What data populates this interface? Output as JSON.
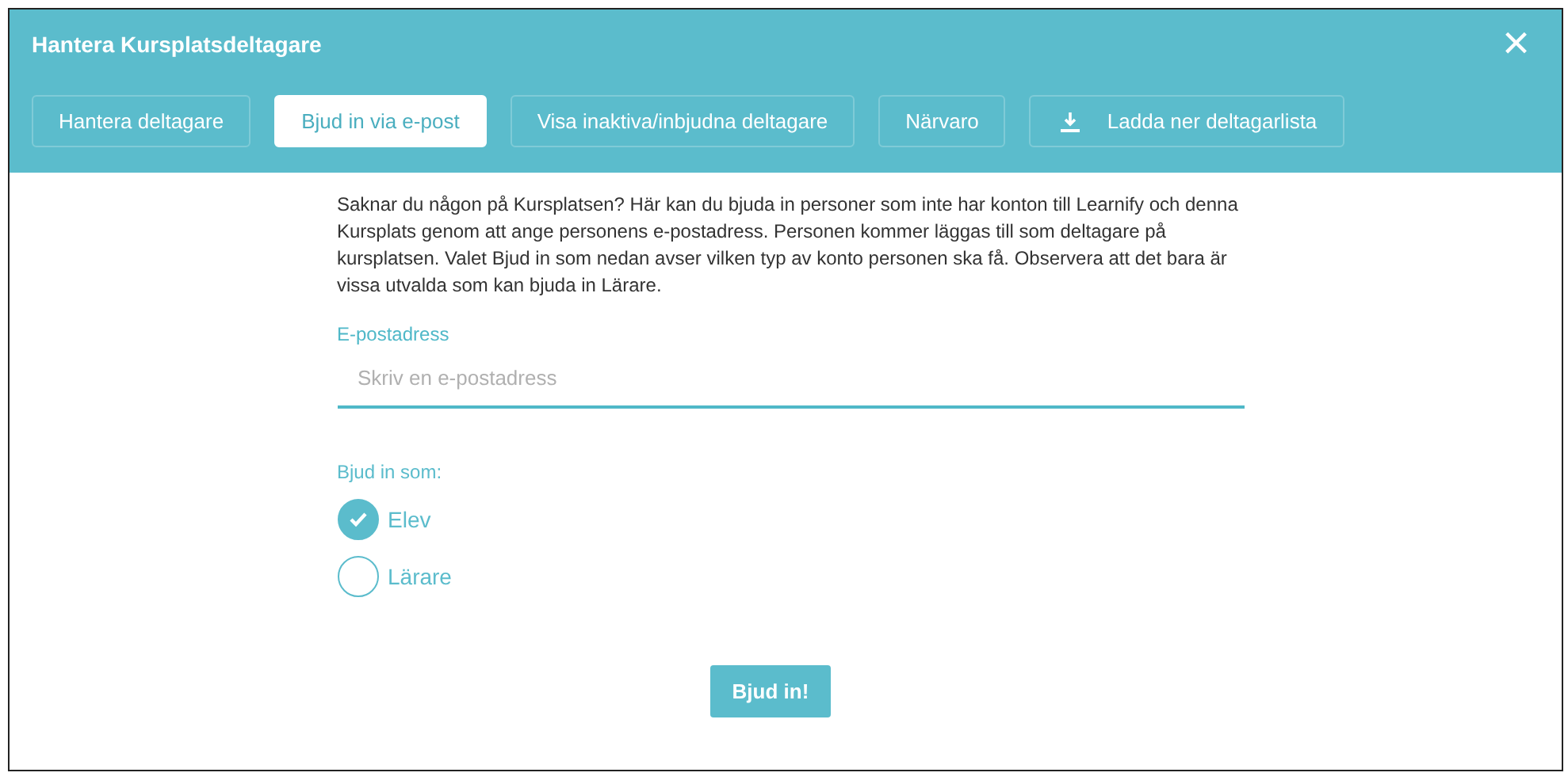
{
  "window": {
    "title": "Hantera Kursplatsdeltagare",
    "close": "×"
  },
  "tabs": [
    {
      "label": "Hantera deltagare",
      "selected": false,
      "kind": "text"
    },
    {
      "label": "Bjud in via e-post",
      "selected": true,
      "kind": "text"
    },
    {
      "label": "Visa inaktiva/inbjudna deltagare",
      "selected": false,
      "kind": "text"
    },
    {
      "label": "Närvaro",
      "selected": false,
      "kind": "text"
    },
    {
      "label": "Ladda ner deltagarlista",
      "selected": false,
      "kind": "download"
    }
  ],
  "description": "Saknar du någon på Kursplatsen? Här kan du bjuda in personer som inte har konton till Learnify och denna Kursplats genom att ange personens e-postadress. Personen kommer läggas till som deltagare på kursplatsen. Valet Bjud in som nedan avser vilken typ av konto personen ska få. Observera att det bara är vissa utvalda som kan bjuda in Lärare.",
  "email": {
    "label": "E-postadress",
    "placeholder": "Skriv en e-postadress"
  },
  "role": {
    "label": "Bjud in som:",
    "options": [
      {
        "label": "Elev",
        "selected": true
      },
      {
        "label": "Lärare",
        "selected": false
      }
    ]
  },
  "submit": "Bjud in!"
}
